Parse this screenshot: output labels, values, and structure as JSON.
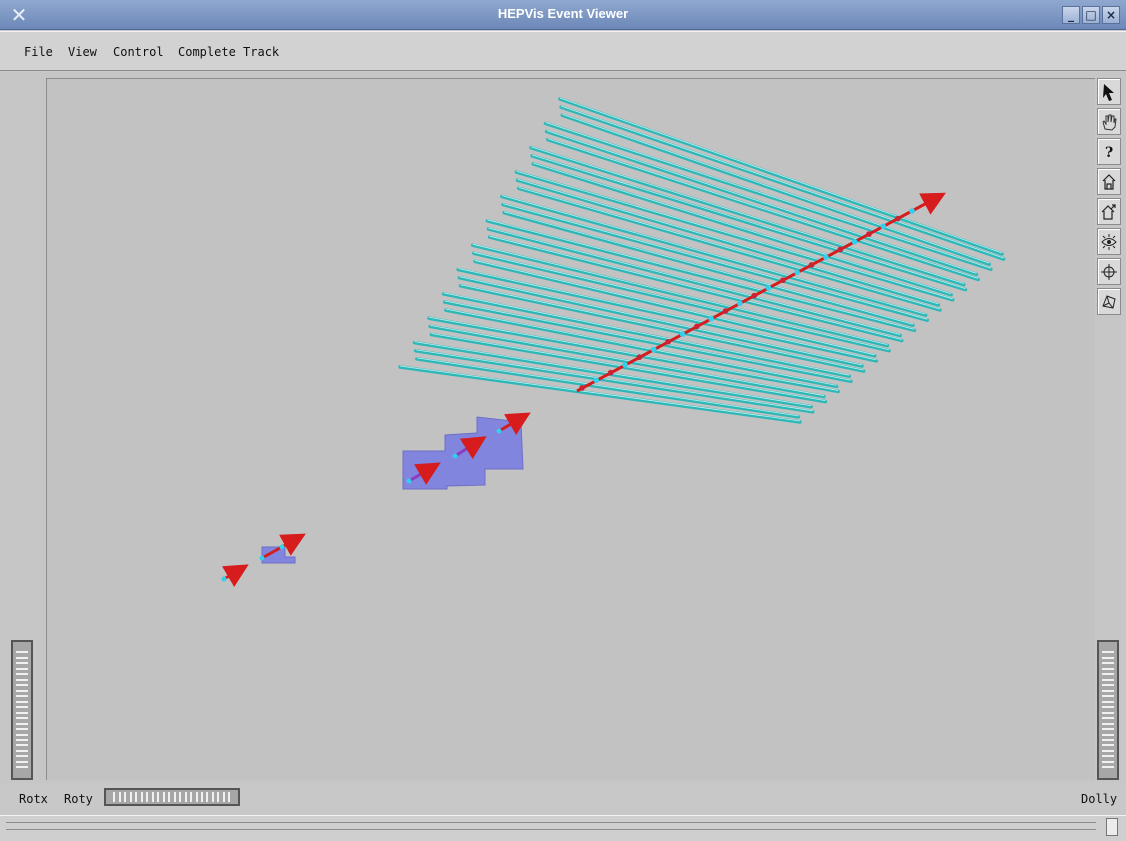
{
  "window": {
    "title": "HEPVis Event Viewer",
    "buttons": {
      "minimize": "_",
      "maximize": "□",
      "close": "×"
    }
  },
  "menu": {
    "items": [
      "File",
      "View",
      "Control",
      "Complete Track"
    ]
  },
  "viewer": {
    "background_color": "#c2c2c2",
    "strip_color": "#2fb7b7",
    "track_color": "#d61c1c",
    "hit_color": "#31d0ec",
    "module_color": "#6f74e6",
    "tools": [
      "arrow-pointer-icon",
      "hand-pan-icon",
      "help-question-icon",
      "home-icon",
      "set-home-icon",
      "view-all-eye-icon",
      "seek-target-icon",
      "perspective-camera-icon"
    ]
  },
  "bottom_controls": {
    "rotx": "Rotx",
    "roty": "Roty",
    "dolly": "Dolly"
  }
}
